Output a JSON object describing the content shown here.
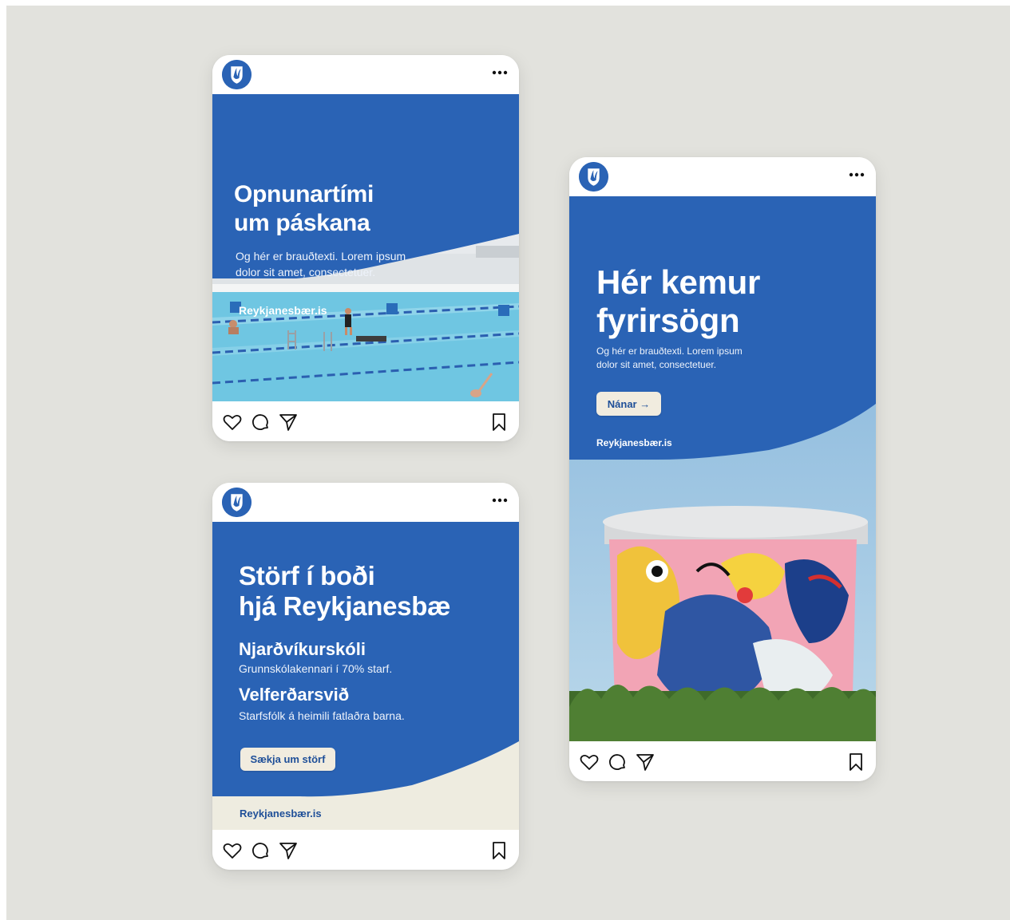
{
  "colors": {
    "background": "#e2e2dd",
    "brand_blue": "#2a63b5",
    "cream": "#eeece0",
    "button_bg": "#f1ecdf",
    "button_text": "#1f4f98"
  },
  "icons": [
    "crest-logo-icon",
    "more-dots-icon",
    "heart-icon",
    "comment-icon",
    "share-icon",
    "bookmark-icon"
  ],
  "post_pool": {
    "headline_line1": "Opnunartími",
    "headline_line2": "um páskana",
    "body_line1": "Og hér er brauðtexti. Lorem ipsum",
    "body_line2": "dolor sit amet, consectetuer.",
    "site": "Reykjanesbær.is"
  },
  "post_jobs": {
    "headline_line1": "Störf í boði",
    "headline_line2": "hjá Reykjanesbæ",
    "job1_title": "Njarðvíkurskóli",
    "job1_desc": "Grunnskólakennari í 70% starf.",
    "job2_title": "Velferðarsvið",
    "job2_desc": "Starfsfólk á heimili fatlaðra barna.",
    "button_label": "Sækja um störf",
    "site": "Reykjanesbær.is"
  },
  "post_tank": {
    "headline_line1": "Hér kemur",
    "headline_line2": "fyrirsögn",
    "body_line1": "Og hér er brauðtexti. Lorem ipsum",
    "body_line2": "dolor sit amet, consectetuer.",
    "button_label": "Nánar →",
    "site": "Reykjanesbær.is"
  }
}
